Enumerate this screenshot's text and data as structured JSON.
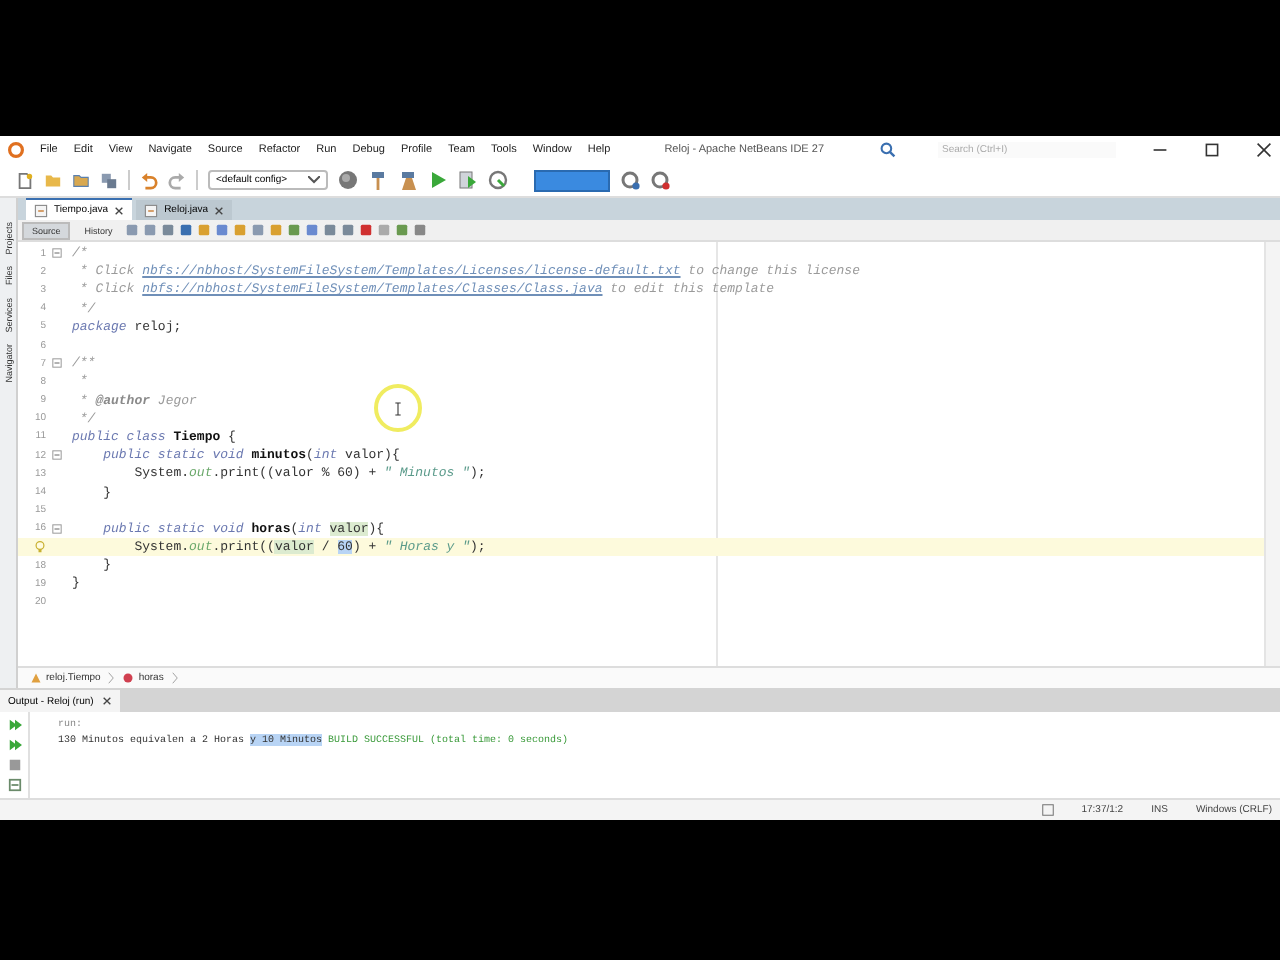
{
  "window": {
    "title": "Reloj - Apache NetBeans IDE 27"
  },
  "menu": [
    "File",
    "Edit",
    "View",
    "Navigate",
    "Source",
    "Refactor",
    "Run",
    "Debug",
    "Profile",
    "Team",
    "Tools",
    "Window",
    "Help"
  ],
  "search": {
    "placeholder": "Search (Ctrl+I)"
  },
  "toolbar": {
    "config": "<default config>"
  },
  "side_tabs": [
    "Projects",
    "Files",
    "Services",
    "Navigator"
  ],
  "tabs": [
    {
      "label": "Tiempo.java",
      "selected": true
    },
    {
      "label": "Reloj.java",
      "selected": false
    }
  ],
  "editor_modes": [
    {
      "label": "Source",
      "selected": true
    },
    {
      "label": "History",
      "selected": false
    }
  ],
  "lines": [
    {
      "number": "1",
      "fold": true,
      "current": false,
      "segments": [
        {
          "kind": "comment",
          "text": "/*"
        }
      ]
    },
    {
      "number": "2",
      "fold": false,
      "current": false,
      "segments": [
        {
          "kind": "comment",
          "text": " * Click "
        },
        {
          "kind": "link",
          "text": "nbfs://nbhost/SystemFileSystem/Templates/Licenses/license-default.txt"
        },
        {
          "kind": "comment",
          "text": " to change this license"
        }
      ]
    },
    {
      "number": "3",
      "fold": false,
      "current": false,
      "segments": [
        {
          "kind": "comment",
          "text": " * Click "
        },
        {
          "kind": "link",
          "text": "nbfs://nbhost/SystemFileSystem/Templates/Classes/Class.java"
        },
        {
          "kind": "comment",
          "text": " to edit this template"
        }
      ]
    },
    {
      "number": "4",
      "fold": false,
      "current": false,
      "segments": [
        {
          "kind": "comment",
          "text": " */"
        }
      ]
    },
    {
      "number": "5",
      "fold": false,
      "current": false,
      "segments": [
        {
          "kind": "keyword",
          "text": "package"
        },
        {
          "kind": "plain",
          "text": " reloj;"
        }
      ]
    },
    {
      "number": "6",
      "fold": false,
      "current": false
    },
    {
      "number": "7",
      "fold": true,
      "current": false,
      "segments": [
        {
          "kind": "comment",
          "text": "/**"
        }
      ]
    },
    {
      "number": "8",
      "fold": false,
      "current": false,
      "segments": [
        {
          "kind": "comment",
          "text": " *"
        }
      ]
    },
    {
      "number": "9",
      "fold": false,
      "current": false,
      "segments": [
        {
          "kind": "comment",
          "text": " * "
        },
        {
          "kind": "tag",
          "text": "@author"
        },
        {
          "kind": "comment",
          "text": " Jegor"
        }
      ]
    },
    {
      "number": "10",
      "fold": false,
      "current": false,
      "segments": [
        {
          "kind": "comment",
          "text": " */"
        }
      ]
    },
    {
      "number": "11",
      "fold": false,
      "current": false,
      "segments": [
        {
          "kind": "keyword",
          "text": "public class "
        },
        {
          "kind": "bold",
          "text": "Tiempo"
        },
        {
          "kind": "plain",
          "text": " {"
        }
      ]
    },
    {
      "number": "12",
      "fold": true,
      "current": false,
      "segments": [
        {
          "kind": "keyword",
          "text": "    public static void "
        },
        {
          "kind": "bold",
          "text": "minutos"
        },
        {
          "kind": "plain",
          "text": "("
        },
        {
          "kind": "keyword",
          "text": "int"
        },
        {
          "kind": "plain",
          "text": " valor){"
        }
      ]
    },
    {
      "number": "13",
      "fold": false,
      "current": false,
      "segments": [
        {
          "kind": "plain",
          "text": "        System."
        },
        {
          "kind": "field",
          "text": "out"
        },
        {
          "kind": "plain",
          "text": ".print((valor % 60) + "
        },
        {
          "kind": "string",
          "text": "\" Minutos \""
        },
        {
          "kind": "plain",
          "text": ");"
        }
      ]
    },
    {
      "number": "14",
      "fold": false,
      "current": false,
      "segments": [
        {
          "kind": "plain",
          "text": "    }"
        }
      ]
    },
    {
      "number": "15",
      "fold": false,
      "current": false
    },
    {
      "number": "16",
      "fold": true,
      "current": false,
      "segments": [
        {
          "kind": "keyword",
          "text": "    public static void "
        },
        {
          "kind": "bold",
          "text": "horas"
        },
        {
          "kind": "plain",
          "text": "("
        },
        {
          "kind": "keyword",
          "text": "int "
        },
        {
          "kind": "mark",
          "text": "valor"
        },
        {
          "kind": "plain",
          "text": "){"
        }
      ]
    },
    {
      "hint": true,
      "fold": false,
      "current": true,
      "segments": [
        {
          "kind": "plain",
          "text": "        System."
        },
        {
          "kind": "field",
          "text": "out"
        },
        {
          "kind": "plain",
          "text": ".print(("
        },
        {
          "kind": "mark",
          "text": "valor"
        },
        {
          "kind": "plain",
          "text": " / "
        },
        {
          "kind": "selected",
          "text": "60"
        },
        {
          "kind": "plain",
          "text": ") + "
        },
        {
          "kind": "string",
          "text": "\" Horas y \""
        },
        {
          "kind": "plain",
          "text": ");"
        }
      ]
    },
    {
      "number": "18",
      "fold": false,
      "current": false,
      "segments": [
        {
          "kind": "plain",
          "text": "    }"
        }
      ]
    },
    {
      "number": "19",
      "fold": false,
      "current": false,
      "segments": [
        {
          "kind": "plain",
          "text": "}"
        }
      ]
    },
    {
      "number": "20",
      "fold": false,
      "current": false
    }
  ],
  "breadcrumbs": [
    "reloj.Tiempo",
    "horas"
  ],
  "output": {
    "title": "Output - Reloj (run)",
    "lines": [
      [
        {
          "kind": "info",
          "text": "run:"
        }
      ],
      [
        {
          "kind": "plain",
          "text": "130 Minutos equivalen a 2 Horas "
        },
        {
          "kind": "selected",
          "text": "y 10 Minutos"
        },
        {
          "kind": "success",
          "text": " BUILD SUCCESSFUL (total time: 0 seconds)"
        }
      ]
    ]
  },
  "status_bar": {
    "position": "17:37/1:2",
    "mode": "INS",
    "line_ending": "Windows (CRLF)"
  }
}
